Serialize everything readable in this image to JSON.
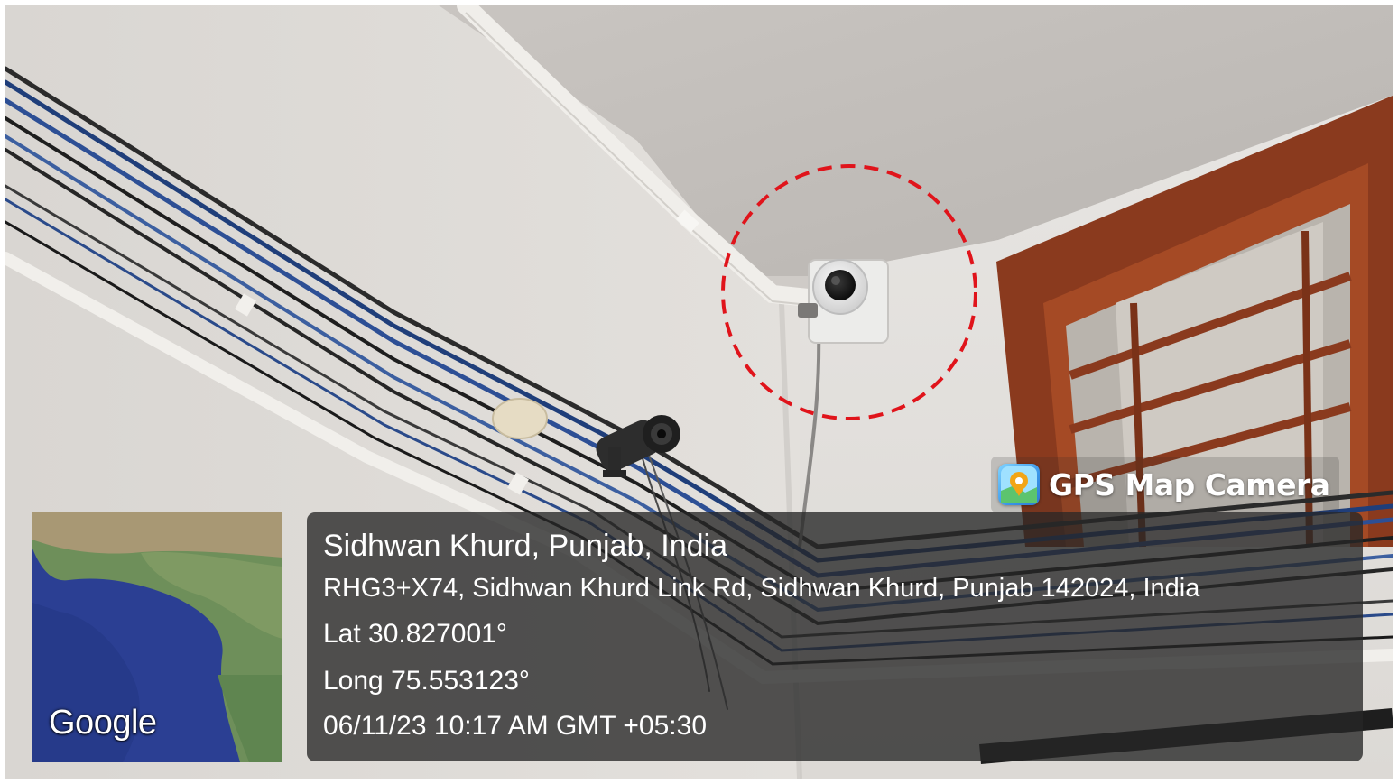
{
  "watermark": {
    "icon": "gps-map-camera-app-icon",
    "label": "GPS Map Camera"
  },
  "map_thumbnail": {
    "provider_logo": "Google"
  },
  "location": {
    "place": "Sidhwan Khurd, Punjab, India",
    "address": "RHG3+X74, Sidhwan Khurd Link Rd, Sidhwan Khurd, Punjab 142024, India",
    "latitude": "Lat 30.827001°",
    "longitude": "Long 75.553123°",
    "datetime": "06/11/23 10:17 AM GMT +05:30"
  },
  "annotation": {
    "marker_color": "#e0141b"
  },
  "colors": {
    "wall": "#d8d5d1",
    "window_frame": "#8a3a1e",
    "panel": "#262626"
  }
}
